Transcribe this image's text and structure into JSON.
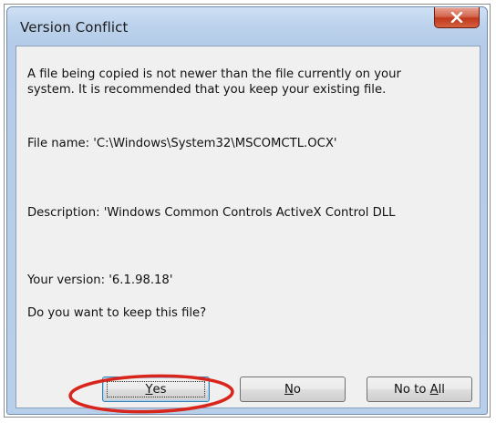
{
  "window": {
    "title": "Version Conflict"
  },
  "message": {
    "line1": "A file being copied is not newer than the file currently on your",
    "line2": "system. It is recommended that you keep your existing file."
  },
  "file_name": "File name:   'C:\\Windows\\System32\\MSCOMCTL.OCX'",
  "description": "Description:  'Windows Common Controls ActiveX Control DLL",
  "your_version": "Your version:  '6.1.98.18'",
  "question": "Do you want to keep this file?",
  "buttons": {
    "yes": {
      "mnemonic": "Y",
      "rest": "es"
    },
    "no": {
      "mnemonic": "N",
      "rest": "o"
    },
    "no_to_all": {
      "prefix": "No to ",
      "mnemonic": "A",
      "rest": "ll"
    }
  },
  "colors": {
    "highlight_ring": "#d9261c",
    "close_button": "#c8432a"
  }
}
